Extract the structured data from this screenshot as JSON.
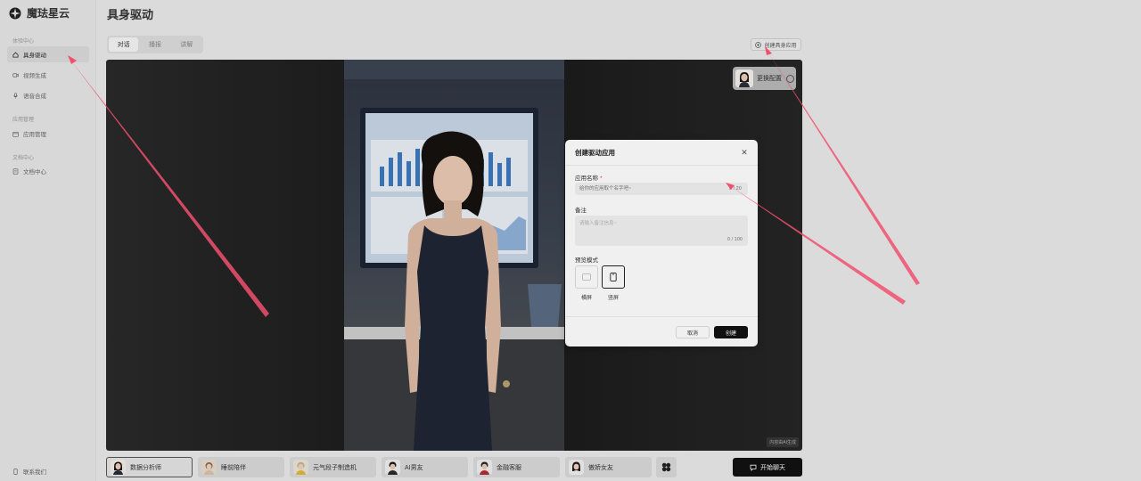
{
  "app": {
    "name": "魔珐星云",
    "page_title": "具身驱动"
  },
  "sidebar": {
    "groups": [
      {
        "label": "体验中心"
      },
      {
        "label": "应用管理"
      },
      {
        "label": "文档中心"
      }
    ],
    "items": [
      {
        "label": "具身驱动",
        "icon": "home-icon",
        "active": true
      },
      {
        "label": "视频生成",
        "icon": "video-icon"
      },
      {
        "label": "语音合成",
        "icon": "mic-icon"
      },
      {
        "label": "应用管理",
        "icon": "calendar-icon"
      },
      {
        "label": "文档中心",
        "icon": "doc-icon"
      }
    ],
    "footer": {
      "label": "联系我们"
    }
  },
  "header": {
    "tabs": [
      {
        "label": "对话",
        "active": true
      },
      {
        "label": "播报"
      },
      {
        "label": "讲解"
      }
    ],
    "create_button": "创建具身应用"
  },
  "stage": {
    "swap_config": "更换配置",
    "tag": "内容由AI生成"
  },
  "modal": {
    "title": "创建驱动应用",
    "name_label": "应用名称",
    "name_required": "*",
    "name_placeholder": "给你的应用取个名字吧~",
    "name_count": "0 / 20",
    "note_label": "备注",
    "note_placeholder": "请输入备注信息~",
    "note_count": "0 / 100",
    "preview_label": "预览模式",
    "options": [
      {
        "label": "横屏",
        "selected": false
      },
      {
        "label": "竖屏",
        "selected": true
      }
    ],
    "cancel": "取消",
    "create": "创建"
  },
  "characters": [
    {
      "label": "数据分析师",
      "active": true
    },
    {
      "label": "睡前陪伴"
    },
    {
      "label": "元气段子制造机"
    },
    {
      "label": "AI男友"
    },
    {
      "label": "金融客服"
    },
    {
      "label": "傲娇女友"
    }
  ],
  "start_chat": "开始聊天",
  "colors": {
    "annotation_arrow": "#f0506e",
    "primary_button": "#111111",
    "required": "#e0413e"
  }
}
